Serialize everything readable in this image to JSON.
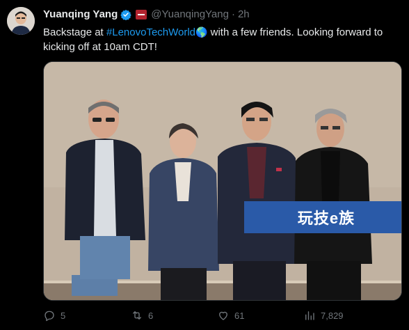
{
  "author": {
    "display_name": "Yuanqing Yang",
    "handle": "@YuanqingYang",
    "separator": "·",
    "time": "2h"
  },
  "tweet": {
    "text_before": "Backstage at ",
    "hashtag": "#LenovoTechWorld",
    "globe": "🌎",
    "text_after": " with a few friends. Looking forward to kicking off at 10am CDT!"
  },
  "media": {
    "watermark_text": "玩技e族"
  },
  "actions": {
    "replies": "5",
    "retweets": "6",
    "likes": "61",
    "views": "7,829"
  },
  "colors": {
    "background": "#000000",
    "text": "#e7e9ea",
    "muted": "#71767b",
    "link": "#1d9bf0",
    "verified": "#1d9bf0"
  }
}
